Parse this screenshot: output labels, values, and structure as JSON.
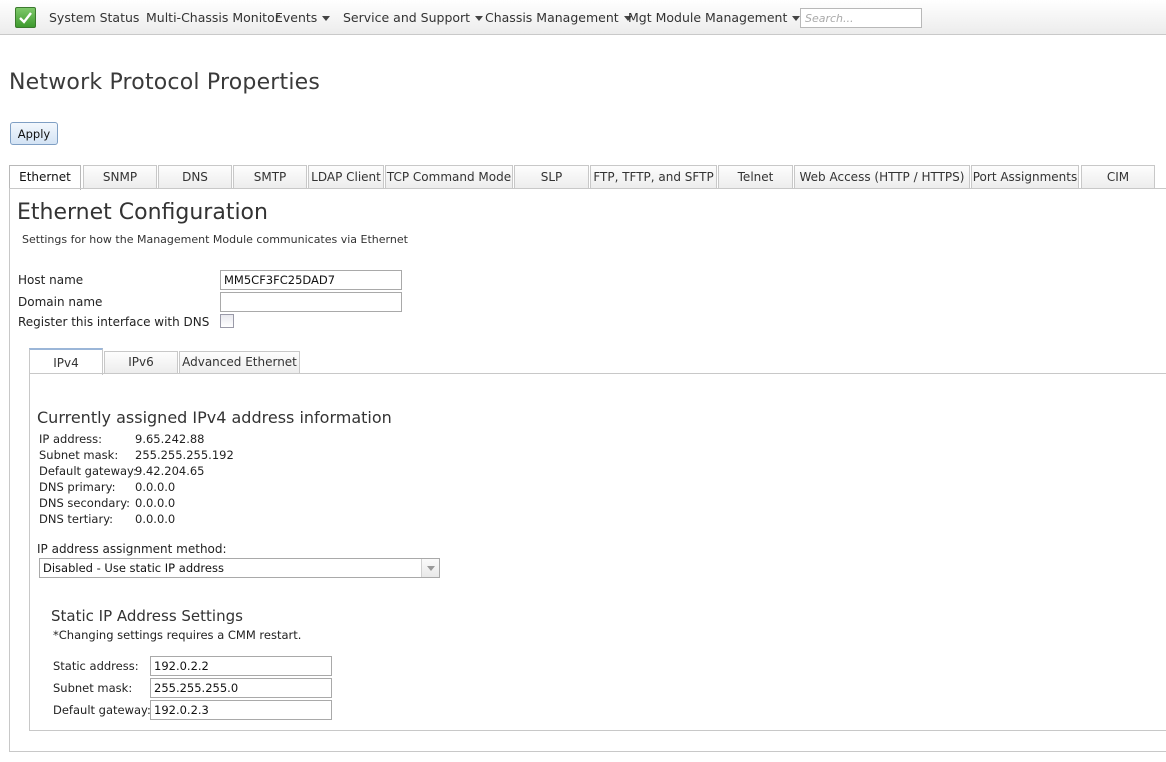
{
  "nav": {
    "status_icon": "checkmark-icon",
    "items": [
      {
        "label": "System Status",
        "dropdown": false
      },
      {
        "label": "Multi-Chassis Monitor",
        "dropdown": false
      },
      {
        "label": "Events",
        "dropdown": true
      },
      {
        "label": "Service and Support",
        "dropdown": true
      },
      {
        "label": "Chassis Management",
        "dropdown": true
      },
      {
        "label": "Mgt Module Management",
        "dropdown": true
      }
    ],
    "search_placeholder": "Search...",
    "accent_color": "#3e9a2e"
  },
  "page": {
    "title": "Network Protocol Properties",
    "apply_label": "Apply"
  },
  "tabs": [
    "Ethernet",
    "SNMP",
    "DNS",
    "SMTP",
    "LDAP Client",
    "TCP Command Mode",
    "SLP",
    "FTP, TFTP, and SFTP",
    "Telnet",
    "Web Access (HTTP / HTTPS)",
    "Port Assignments",
    "CIM"
  ],
  "active_tab": "Ethernet",
  "ethernet": {
    "title": "Ethernet Configuration",
    "description": "Settings for how the Management Module communicates via Ethernet",
    "host_name_label": "Host name",
    "host_name_value": "MM5CF3FC25DAD7",
    "domain_name_label": "Domain name",
    "domain_name_value": "",
    "register_dns_label": "Register this interface with DNS",
    "register_dns_checked": false
  },
  "subtabs": [
    "IPv4",
    "IPv6",
    "Advanced Ethernet"
  ],
  "active_subtab": "IPv4",
  "ipv4": {
    "title": "Currently assigned IPv4 address information",
    "info": [
      {
        "label": "IP address:",
        "value": "9.65.242.88"
      },
      {
        "label": "Subnet mask:",
        "value": "255.255.255.192"
      },
      {
        "label": "Default gateway:",
        "value": "9.42.204.65"
      },
      {
        "label": "DNS primary:",
        "value": "0.0.0.0"
      },
      {
        "label": "DNS secondary:",
        "value": "0.0.0.0"
      },
      {
        "label": "DNS tertiary:",
        "value": "0.0.0.0"
      }
    ],
    "method_label": "IP address assignment method:",
    "method_value": "Disabled - Use static IP address",
    "static": {
      "title": "Static IP Address Settings",
      "note": "*Changing settings requires a CMM restart.",
      "address_label": "Static address:",
      "address_value": "192.0.2.2",
      "subnet_label": "Subnet mask:",
      "subnet_value": "255.255.255.0",
      "gateway_label": "Default gateway:",
      "gateway_value": "192.0.2.3"
    }
  }
}
